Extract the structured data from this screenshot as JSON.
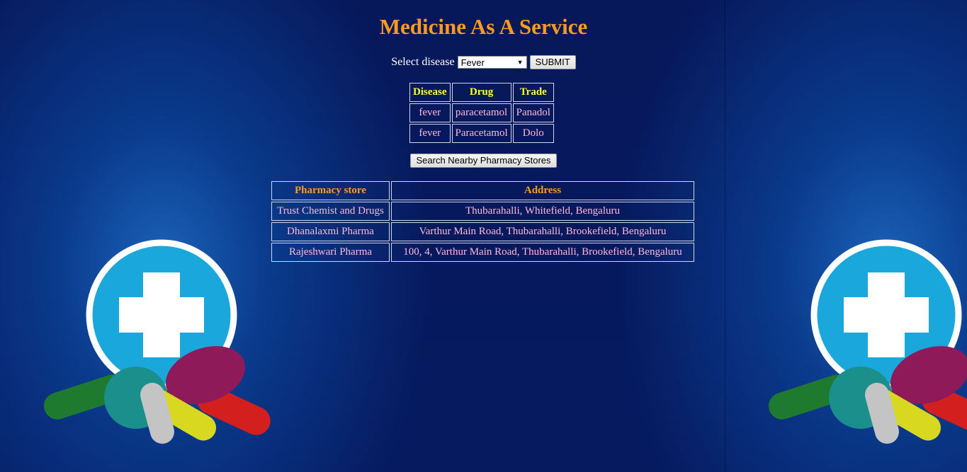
{
  "app": {
    "title": "Medicine As A Service"
  },
  "disease_form": {
    "label": "Select disease",
    "selected": "Fever",
    "submit_label": "SUBMIT"
  },
  "drug_table": {
    "headers": [
      "Disease",
      "Drug",
      "Trade"
    ],
    "rows": [
      [
        "fever",
        "paracetamol",
        "Panadol"
      ],
      [
        "fever",
        "Paracetamol",
        "Dolo"
      ]
    ]
  },
  "search_button_label": "Search Nearby Pharmacy Stores",
  "pharmacy_table": {
    "headers": [
      "Pharmacy store",
      "Address"
    ],
    "rows": [
      [
        "Trust Chemist and Drugs",
        "Thubarahalli, Whitefield, Bengaluru"
      ],
      [
        "Dhanalaxmi Pharma",
        "Varthur Main Road, Thubarahalli, Brookefield, Bengaluru"
      ],
      [
        "Rajeshwari Pharma",
        "100, 4, Varthur Main Road, Thubarahalli, Brookefield, Bengaluru"
      ]
    ]
  },
  "colors": {
    "title": "#ff9a1f",
    "drug_header": "#ffff2e",
    "cell_text": "#ffb9d8",
    "background": "#061a60"
  },
  "icons": [
    "medical-cross-icon",
    "pills-illustration"
  ]
}
